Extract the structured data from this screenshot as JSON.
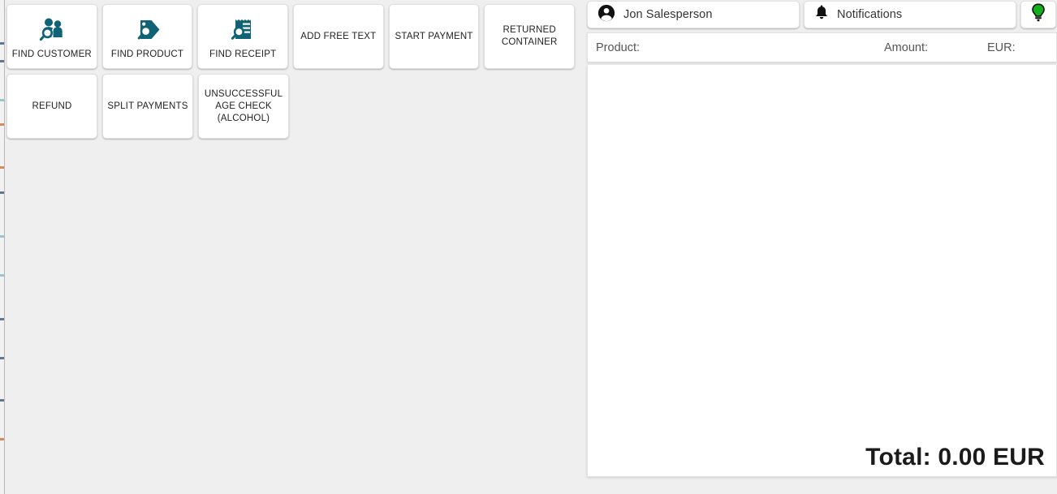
{
  "theme": {
    "background": "#efefef",
    "panel": "#ffffff",
    "icon_teal": "#0f6374",
    "bulb_green": "#12b01a",
    "text_dark": "#222222",
    "text_muted": "#555555"
  },
  "action_pad": {
    "rows": [
      [
        {
          "id": "find-customer",
          "label": "FIND CUSTOMER",
          "icon": "find-customer-icon"
        },
        {
          "id": "find-product",
          "label": "FIND PRODUCT",
          "icon": "find-product-icon"
        },
        {
          "id": "find-receipt",
          "label": "FIND RECEIPT",
          "icon": "find-receipt-icon"
        },
        {
          "id": "add-free-text",
          "label": "ADD FREE TEXT",
          "icon": null
        },
        {
          "id": "start-payment",
          "label": "START PAYMENT",
          "icon": null
        },
        {
          "id": "returned-container",
          "label": "RETURNED\nCONTAINER",
          "icon": null
        }
      ],
      [
        {
          "id": "refund",
          "label": "REFUND",
          "icon": null
        },
        {
          "id": "split-payments",
          "label": "SPLIT PAYMENTS",
          "icon": null
        },
        {
          "id": "unsuccessful-age-check",
          "label": "UNSUCCESSFUL\nAGE CHECK\n(ALCOHOL)",
          "icon": null
        }
      ]
    ]
  },
  "top_bar": {
    "user": {
      "icon": "user-account-icon",
      "label": "Jon Salesperson"
    },
    "notifications": {
      "icon": "bell-icon",
      "label": "Notifications"
    },
    "hint": {
      "icon": "lightbulb-icon",
      "label": ""
    }
  },
  "receipt": {
    "columns": {
      "product": "Product:",
      "amount": "Amount:",
      "currency": "EUR:"
    },
    "lines": [],
    "total": "Total: 0.00 EUR"
  }
}
